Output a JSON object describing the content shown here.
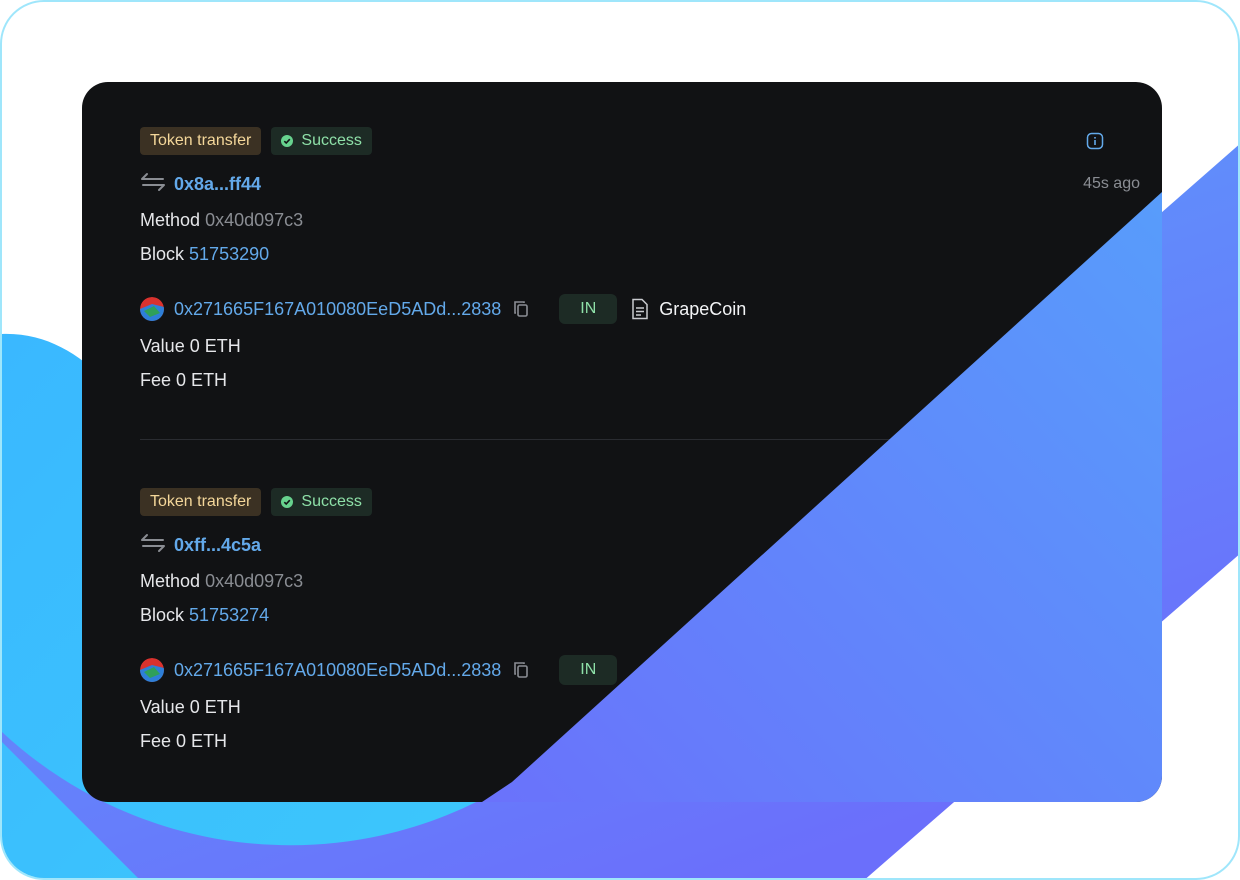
{
  "header": {
    "time": "45s ago"
  },
  "transactions": [
    {
      "type_label": "Token transfer",
      "status_label": "Success",
      "hash": "0x8a...ff44",
      "method_label": "Method",
      "method_value": "0x40d097c3",
      "block_label": "Block",
      "block_value": "51753290",
      "address": "0x271665F167A010080EeD5ADd...2838",
      "direction": "IN",
      "token_name": "GrapeCoin",
      "value_label": "Value",
      "value": "0 ETH",
      "fee_label": "Fee",
      "fee": "0 ETH"
    },
    {
      "type_label": "Token transfer",
      "status_label": "Success",
      "hash": "0xff...4c5a",
      "method_label": "Method",
      "method_value": "0x40d097c3",
      "block_label": "Block",
      "block_value": "51753274",
      "address": "0x271665F167A010080EeD5ADd...2838",
      "direction": "IN",
      "value_label": "Value",
      "value": "0 ETH",
      "fee_label": "Fee",
      "fee": "0 ETH"
    }
  ],
  "colors": {
    "card_bg": "#111214",
    "link": "#63a9ea",
    "success": "#8ee0a8",
    "tag_type_text": "#f4d79a",
    "wave_start": "#3cc8fb",
    "wave_end": "#6b72fb"
  },
  "icons": [
    "info-icon",
    "transfer-icon",
    "success-check-icon",
    "copy-icon",
    "document-icon",
    "avatar-icon"
  ]
}
